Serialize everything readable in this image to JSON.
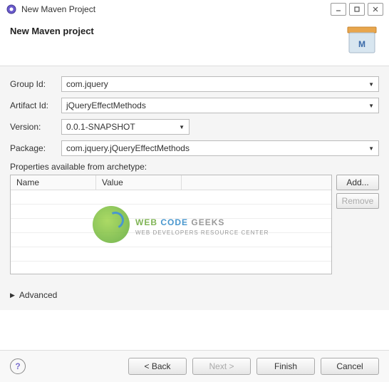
{
  "titlebar": {
    "title": "New Maven Project"
  },
  "header": {
    "title": "New Maven project"
  },
  "form": {
    "group_id_label": "Group Id:",
    "group_id_value": "com.jquery",
    "artifact_id_label": "Artifact Id:",
    "artifact_id_value": "jQueryEffectMethods",
    "version_label": "Version:",
    "version_value": "0.0.1-SNAPSHOT",
    "package_label": "Package:",
    "package_value": "com.jquery.jQueryEffectMethods"
  },
  "props": {
    "label": "Properties available from archetype:",
    "col_name": "Name",
    "col_value": "Value",
    "add_btn": "Add...",
    "remove_btn": "Remove"
  },
  "advanced": {
    "label": "Advanced"
  },
  "footer": {
    "back": "< Back",
    "next": "Next >",
    "finish": "Finish",
    "cancel": "Cancel",
    "help": "?"
  },
  "watermark": {
    "web": "WEB ",
    "code": "CODE ",
    "geeks": "GEEKS",
    "sub": "WEB DEVELOPERS RESOURCE CENTER"
  }
}
